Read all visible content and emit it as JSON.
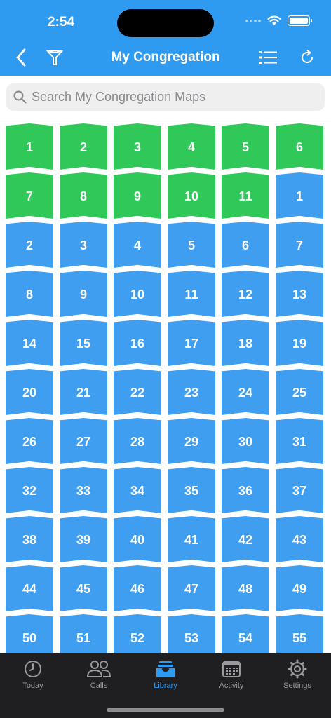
{
  "status_bar": {
    "time": "2:54"
  },
  "nav": {
    "title": "My Congregation",
    "back_icon": "chevron-left-icon",
    "filter_icon": "funnel-icon",
    "list_icon": "list-icon",
    "refresh_icon": "refresh-icon"
  },
  "search": {
    "placeholder": "Search My Congregation Maps",
    "value": ""
  },
  "colors": {
    "accent": "#2f9bf0",
    "green": "#30c859",
    "blue": "#409ef1",
    "tabbar": "#1f1f21"
  },
  "maps": [
    {
      "label": "1",
      "status": "green"
    },
    {
      "label": "2",
      "status": "green"
    },
    {
      "label": "3",
      "status": "green"
    },
    {
      "label": "4",
      "status": "green"
    },
    {
      "label": "5",
      "status": "green"
    },
    {
      "label": "6",
      "status": "green"
    },
    {
      "label": "7",
      "status": "green"
    },
    {
      "label": "8",
      "status": "green"
    },
    {
      "label": "9",
      "status": "green"
    },
    {
      "label": "10",
      "status": "green"
    },
    {
      "label": "11",
      "status": "green"
    },
    {
      "label": "1",
      "status": "blue"
    },
    {
      "label": "2",
      "status": "blue"
    },
    {
      "label": "3",
      "status": "blue"
    },
    {
      "label": "4",
      "status": "blue"
    },
    {
      "label": "5",
      "status": "blue"
    },
    {
      "label": "6",
      "status": "blue"
    },
    {
      "label": "7",
      "status": "blue"
    },
    {
      "label": "8",
      "status": "blue"
    },
    {
      "label": "9",
      "status": "blue"
    },
    {
      "label": "10",
      "status": "blue"
    },
    {
      "label": "11",
      "status": "blue"
    },
    {
      "label": "12",
      "status": "blue"
    },
    {
      "label": "13",
      "status": "blue"
    },
    {
      "label": "14",
      "status": "blue"
    },
    {
      "label": "15",
      "status": "blue"
    },
    {
      "label": "16",
      "status": "blue"
    },
    {
      "label": "17",
      "status": "blue"
    },
    {
      "label": "18",
      "status": "blue"
    },
    {
      "label": "19",
      "status": "blue"
    },
    {
      "label": "20",
      "status": "blue"
    },
    {
      "label": "21",
      "status": "blue"
    },
    {
      "label": "22",
      "status": "blue"
    },
    {
      "label": "23",
      "status": "blue"
    },
    {
      "label": "24",
      "status": "blue"
    },
    {
      "label": "25",
      "status": "blue"
    },
    {
      "label": "26",
      "status": "blue"
    },
    {
      "label": "27",
      "status": "blue"
    },
    {
      "label": "28",
      "status": "blue"
    },
    {
      "label": "29",
      "status": "blue"
    },
    {
      "label": "30",
      "status": "blue"
    },
    {
      "label": "31",
      "status": "blue"
    },
    {
      "label": "32",
      "status": "blue"
    },
    {
      "label": "33",
      "status": "blue"
    },
    {
      "label": "34",
      "status": "blue"
    },
    {
      "label": "35",
      "status": "blue"
    },
    {
      "label": "36",
      "status": "blue"
    },
    {
      "label": "37",
      "status": "blue"
    },
    {
      "label": "38",
      "status": "blue"
    },
    {
      "label": "39",
      "status": "blue"
    },
    {
      "label": "40",
      "status": "blue"
    },
    {
      "label": "41",
      "status": "blue"
    },
    {
      "label": "42",
      "status": "blue"
    },
    {
      "label": "43",
      "status": "blue"
    },
    {
      "label": "44",
      "status": "blue"
    },
    {
      "label": "45",
      "status": "blue"
    },
    {
      "label": "46",
      "status": "blue"
    },
    {
      "label": "47",
      "status": "blue"
    },
    {
      "label": "48",
      "status": "blue"
    },
    {
      "label": "49",
      "status": "blue"
    },
    {
      "label": "50",
      "status": "blue"
    },
    {
      "label": "51",
      "status": "blue"
    },
    {
      "label": "52",
      "status": "blue"
    },
    {
      "label": "53",
      "status": "blue"
    },
    {
      "label": "54",
      "status": "blue"
    },
    {
      "label": "55",
      "status": "blue"
    }
  ],
  "tabs": [
    {
      "label": "Today",
      "icon": "clock-icon",
      "active": false
    },
    {
      "label": "Calls",
      "icon": "people-icon",
      "active": false
    },
    {
      "label": "Library",
      "icon": "tray-icon",
      "active": true
    },
    {
      "label": "Activity",
      "icon": "calendar-icon",
      "active": false
    },
    {
      "label": "Settings",
      "icon": "gear-icon",
      "active": false
    }
  ]
}
